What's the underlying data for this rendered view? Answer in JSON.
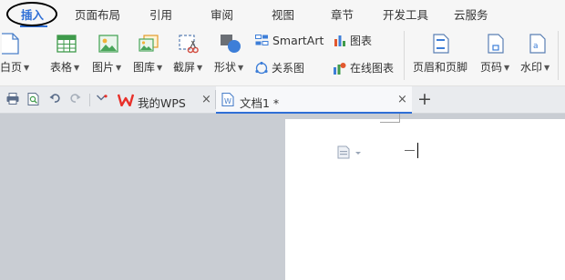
{
  "menubar": {
    "tabs": [
      {
        "label": "插入",
        "active": true
      },
      {
        "label": "页面布局"
      },
      {
        "label": "引用"
      },
      {
        "label": "审阅"
      },
      {
        "label": "视图"
      },
      {
        "label": "章节"
      },
      {
        "label": "开发工具"
      },
      {
        "label": "云服务"
      }
    ]
  },
  "toolbar": {
    "blank_page": "白页",
    "table": "表格",
    "picture": "图片",
    "gallery": "图库",
    "screenshot": "截屏",
    "shape": "形状",
    "smartart": "SmartArt",
    "chart": "图表",
    "relationship": "关系图",
    "online_chart": "在线图表",
    "header_footer": "页眉和页脚",
    "page_number": "页码",
    "watermark": "水印"
  },
  "tabbar": {
    "tabs": [
      {
        "label": "我的WPS"
      },
      {
        "label": "文档1 *"
      }
    ],
    "new_tab": "+",
    "close_glyph": "×"
  },
  "colors": {
    "accent": "#2f6fd6",
    "wps_red": "#e8302a"
  }
}
